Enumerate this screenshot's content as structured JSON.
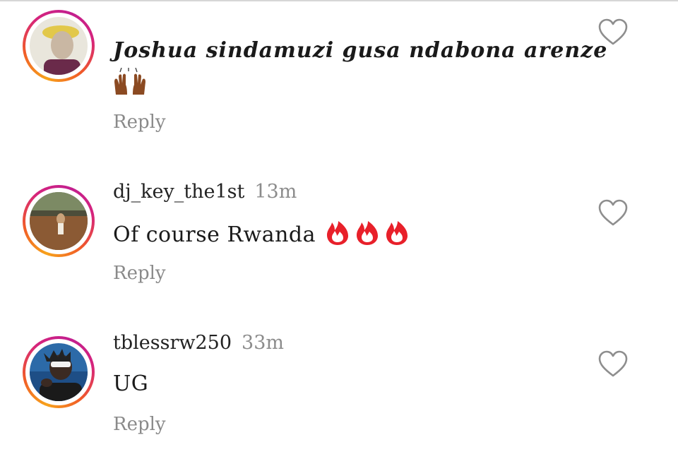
{
  "comments": [
    {
      "username": "",
      "time": "",
      "text": "Joshua sindamuzi gusa ndabona arenze",
      "emoji": "raising-hands",
      "reply_label": "Reply"
    },
    {
      "username": "dj_key_the1st",
      "time": "13m",
      "text": "Of course Rwanda",
      "emoji": "fire x3",
      "reply_label": "Reply"
    },
    {
      "username": "tblessrw250",
      "time": "33m",
      "text": "UG",
      "emoji": "",
      "reply_label": "Reply"
    }
  ],
  "colors": {
    "ring_start": "#f7a21b",
    "ring_end": "#c21f8f",
    "fire": "#e8202a",
    "muted_text": "#8a8a8a"
  },
  "icons": [
    "heart-outline-icon",
    "fire-icon",
    "raising-hands-icon"
  ]
}
